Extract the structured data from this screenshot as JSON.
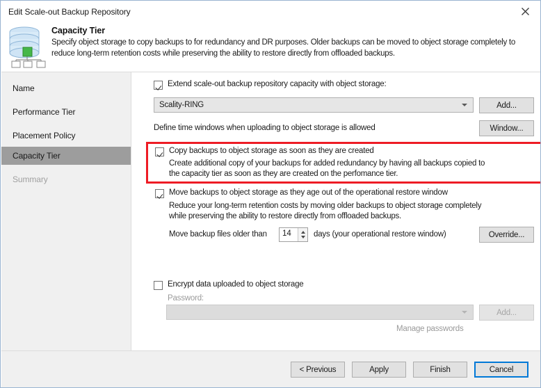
{
  "window": {
    "title": "Edit Scale-out Backup Repository",
    "close_icon": "close-icon"
  },
  "header": {
    "icon": "capacity-tier-database-icon",
    "title": "Capacity Tier",
    "description": "Specify object storage to copy backups to for redundancy and DR purposes. Older backups can be moved to object storage completely to reduce long-term retention costs while preserving the ability to restore directly from offloaded backups."
  },
  "sidebar": {
    "items": [
      {
        "label": "Name",
        "selected": false,
        "disabled": false
      },
      {
        "label": "Performance Tier",
        "selected": false,
        "disabled": false
      },
      {
        "label": "Placement Policy",
        "selected": false,
        "disabled": false
      },
      {
        "label": "Capacity Tier",
        "selected": true,
        "disabled": false
      },
      {
        "label": "Summary",
        "selected": false,
        "disabled": true
      }
    ],
    "selected_bg": "#9d9d9d"
  },
  "main": {
    "extend": {
      "label": "Extend scale-out backup repository capacity with object storage:",
      "checked": true,
      "repository_value": "Scality-RING",
      "add_button": "Add..."
    },
    "time_window": {
      "label": "Define time windows when uploading to object storage is allowed",
      "button": "Window..."
    },
    "copy_backups": {
      "label": "Copy backups to object storage as soon as they are created",
      "checked": true,
      "description_line1": "Create additional copy of your backups for added redundancy by having all backups copied to",
      "description_line2": "the capacity tier as soon as they are created on the perfomance tier.",
      "highlight_color": "#ee1c25"
    },
    "move_backups": {
      "label": "Move backups to object storage as they age out of the operational restore window",
      "checked": true,
      "description_line1": "Reduce your long-term retention costs by moving older backups to object storage completely",
      "description_line2": "while preserving the ability to restore directly from offloaded backups.",
      "age_prefix": "Move backup files older than",
      "age_value": "14",
      "age_suffix": "days (your operational restore window)",
      "override_button": "Override..."
    },
    "encryption": {
      "label": "Encrypt data uploaded to object storage",
      "checked": false,
      "password_label": "Password:",
      "password_value": "",
      "add_button": "Add...",
      "manage_link": "Manage passwords"
    }
  },
  "footer": {
    "buttons": [
      {
        "label": "< Previous",
        "focused": false
      },
      {
        "label": "Apply",
        "focused": false
      },
      {
        "label": "Finish",
        "focused": false
      },
      {
        "label": "Cancel",
        "focused": true
      }
    ]
  }
}
